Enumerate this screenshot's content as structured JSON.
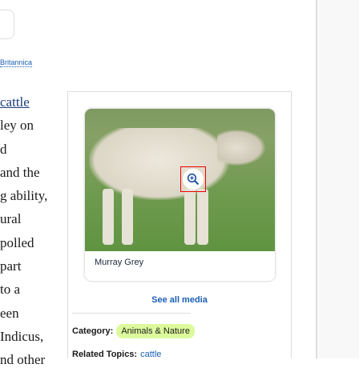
{
  "source_link": "Britannica",
  "source_link_visible": "annica",
  "article": {
    "lines": [
      "cattle",
      "ley on",
      "d",
      "and the",
      "g ability,",
      "ural",
      "polled",
      "part",
      "to a",
      "een",
      "Indicus,",
      "nd other"
    ]
  },
  "media": {
    "caption": "Murray Grey",
    "zoom_icon": "zoom-in-icon",
    "see_all": "See all media"
  },
  "category": {
    "label": "Category:",
    "value": "Animals & Nature",
    "badge_color": "#dcfa9c"
  },
  "related": {
    "label": "Related Topics:",
    "value": "cattle"
  },
  "colors": {
    "link": "#1a5fb4",
    "highlight_border": "#ee0000"
  }
}
